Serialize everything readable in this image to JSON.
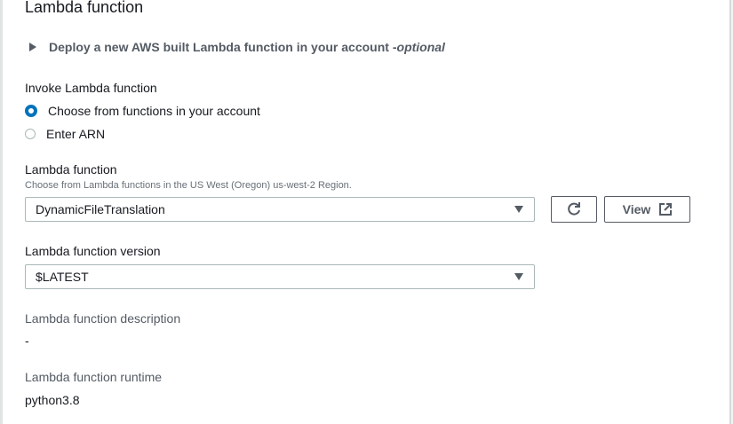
{
  "section_title": "Lambda function",
  "expander": {
    "label": "Deploy a new AWS built Lambda function in your account - ",
    "optional": "optional"
  },
  "invoke": {
    "label": "Invoke Lambda function",
    "options": [
      {
        "label": "Choose from functions in your account",
        "selected": true
      },
      {
        "label": "Enter ARN",
        "selected": false
      }
    ]
  },
  "function": {
    "label": "Lambda function",
    "hint": "Choose from Lambda functions in the US West (Oregon) us-west-2 Region.",
    "value": "DynamicFileTranslation",
    "view_label": "View"
  },
  "version": {
    "label": "Lambda function version",
    "value": "$LATEST"
  },
  "description": {
    "label": "Lambda function description",
    "value": "-"
  },
  "runtime": {
    "label": "Lambda function runtime",
    "value": "python3.8"
  }
}
